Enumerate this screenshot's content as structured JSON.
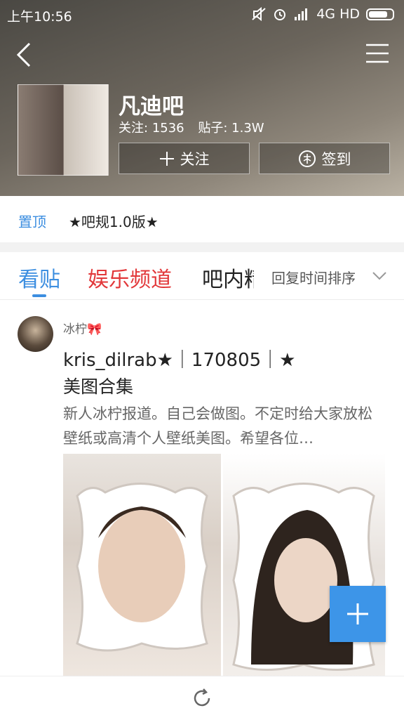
{
  "status_bar": {
    "time": "上午10:56",
    "network": "4G HD"
  },
  "header": {
    "bar_name": "凡迪吧",
    "follow_label": "关注:",
    "follow_count": "1536",
    "posts_label": "贴子:",
    "posts_count": "1.3W",
    "follow_button": "关注",
    "sign_button": "签到"
  },
  "pinned": {
    "tag": "置顶",
    "title": "★吧规1.0版★"
  },
  "tabs": {
    "items": [
      {
        "label": "看贴"
      },
      {
        "label": "娱乐频道"
      },
      {
        "label": "吧内精品"
      }
    ],
    "sort_label": "回复时间排序"
  },
  "post": {
    "author": "冰柠🎀",
    "title": "kris_dilrab★｜170805｜★",
    "subtitle": "美图合集",
    "excerpt": "新人冰柠报道。自己会做图。不定时给大家放松壁纸或高清个人壁纸美图。希望各位…"
  },
  "colors": {
    "accent": "#3c8ee0",
    "red_tab": "#e2383a",
    "fab": "#3d95e8"
  },
  "icons": [
    "back-icon",
    "menu-icon",
    "plus-icon",
    "sign-icon",
    "chevron-down-icon",
    "refresh-icon"
  ]
}
